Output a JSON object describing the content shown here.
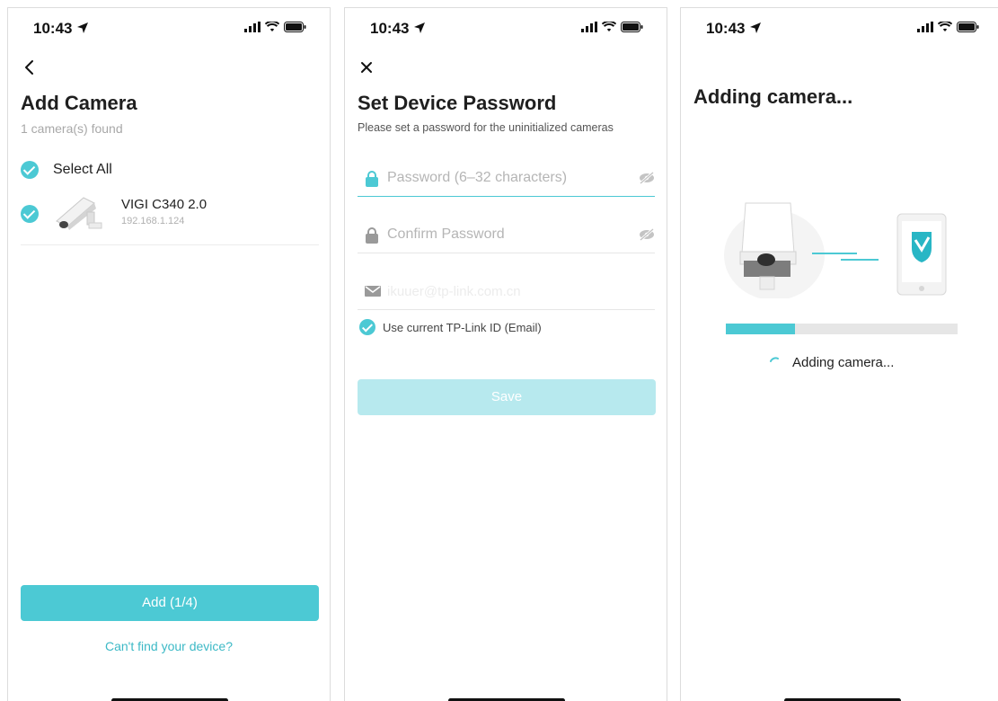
{
  "status_time": "10:43",
  "screen1": {
    "title": "Add Camera",
    "subtitle": "1 camera(s) found",
    "select_all": "Select All",
    "camera_name": "VIGI C340 2.0",
    "camera_ip": "192.168.1.124",
    "add_button": "Add (1/4)",
    "cant_find_link": "Can't find your device?"
  },
  "screen2": {
    "title": "Set Device Password",
    "subtitle": "Please set a password for the uninitialized cameras",
    "password_placeholder": "Password (6–32 characters)",
    "confirm_placeholder": "Confirm Password",
    "email_value": "ikuuer@tp-link.com.cn",
    "use_tplink_id": "Use current TP-Link ID (Email)",
    "save_button": "Save"
  },
  "screen3": {
    "title": "Adding camera...",
    "progress_fraction": 0.3,
    "status_text": "Adding camera..."
  },
  "icons": {
    "back": "chevron-left-icon",
    "close": "close-icon",
    "lock": "lock-icon",
    "eye_off": "eye-off-icon",
    "mail": "mail-icon",
    "spinner": "spinner-icon"
  },
  "colors": {
    "accent": "#4cc9d4",
    "accent_disabled": "#b7e9ee",
    "link": "#3cb9c6",
    "muted": "#b5b5b5"
  }
}
